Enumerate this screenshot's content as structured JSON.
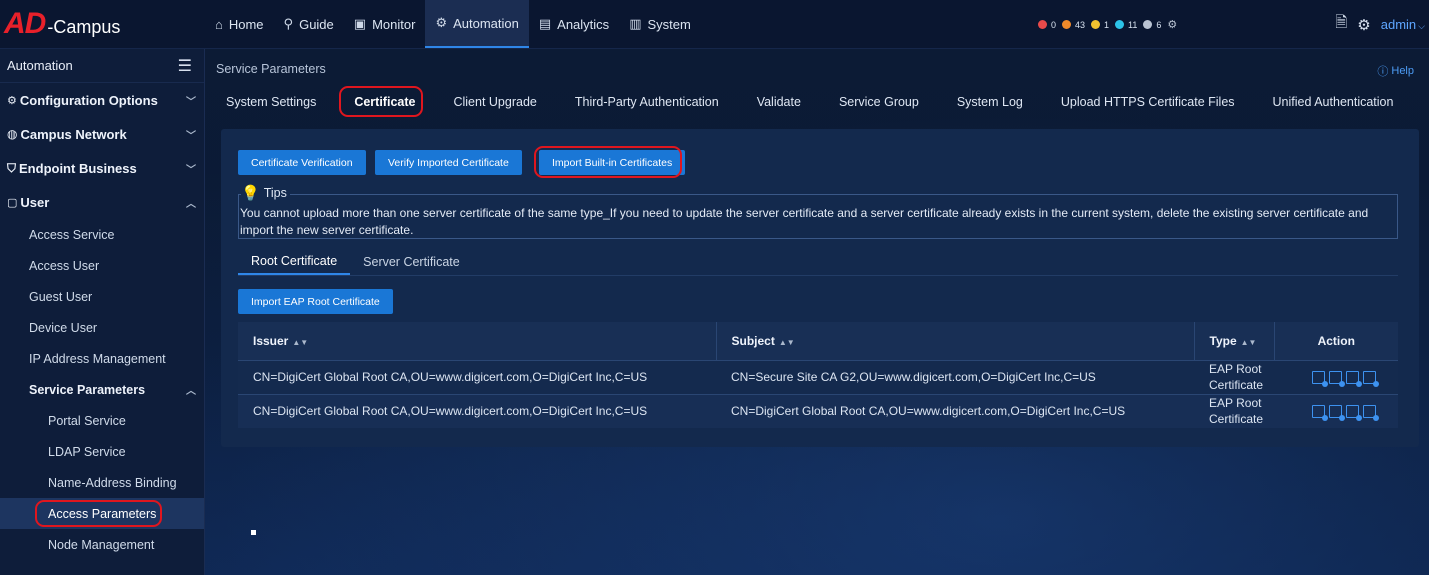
{
  "logo": {
    "brand": "AD",
    "product": "-Campus"
  },
  "topnav": [
    {
      "label": "Home",
      "icon": "home-icon",
      "glyph": "⌂"
    },
    {
      "label": "Guide",
      "icon": "guide-icon",
      "glyph": "⚲"
    },
    {
      "label": "Monitor",
      "icon": "monitor-icon",
      "glyph": "▣"
    },
    {
      "label": "Automation",
      "icon": "automation-icon",
      "glyph": "⚙"
    },
    {
      "label": "Analytics",
      "icon": "analytics-icon",
      "glyph": "▤"
    },
    {
      "label": "System",
      "icon": "system-icon",
      "glyph": "▥"
    }
  ],
  "alarms": [
    {
      "count": "0",
      "color": "#e84a4a"
    },
    {
      "count": "43",
      "color": "#f08a2a"
    },
    {
      "count": "1",
      "color": "#f2c230"
    },
    {
      "count": "11",
      "color": "#2cc3e8"
    },
    {
      "count": "6",
      "color": "#b9c3d2"
    }
  ],
  "user": {
    "name": "admin"
  },
  "sidebar": {
    "title": "Automation",
    "groups": [
      {
        "label": "Configuration Options"
      },
      {
        "label": "Campus Network"
      },
      {
        "label": "Endpoint Business"
      },
      {
        "label": "User"
      }
    ],
    "user_items": [
      "Access Service",
      "Access User",
      "Guest User",
      "Device User",
      "IP Address Management"
    ],
    "service_parameters": {
      "label": "Service Parameters",
      "items": [
        "Portal Service",
        "LDAP Service",
        "Name-Address Binding",
        "Access Parameters",
        "Node Management"
      ]
    }
  },
  "page": {
    "breadcrumb": "Service Parameters",
    "help": "Help",
    "tabs": [
      "System Settings",
      "Certificate",
      "Client Upgrade",
      "Third-Party Authentication",
      "Validate",
      "Service Group",
      "System Log",
      "Upload HTTPS Certificate Files",
      "Unified Authentication"
    ],
    "buttons": {
      "verify": "Certificate Verification",
      "verify_imported": "Verify Imported Certificate",
      "import_builtin": "Import Built-in Certificates",
      "import_eap": "Import EAP Root Certificate"
    },
    "tips": {
      "title": "Tips",
      "text": "You cannot upload more than one server certificate of the same type_If you need to update the server certificate and a server certificate already exists in the current system, delete the existing server certificate and import the new server certificate."
    },
    "subtabs": [
      "Root Certificate",
      "Server Certificate"
    ],
    "table": {
      "columns": [
        "Issuer",
        "Subject",
        "Type",
        "Action"
      ],
      "rows": [
        {
          "issuer": "CN=DigiCert Global Root CA,OU=www.digicert.com,O=DigiCert Inc,C=US",
          "subject": "CN=Secure Site CA G2,OU=www.digicert.com,O=DigiCert Inc,C=US",
          "type": "EAP Root Certificate"
        },
        {
          "issuer": "CN=DigiCert Global Root CA,OU=www.digicert.com,O=DigiCert Inc,C=US",
          "subject": "CN=DigiCert Global Root CA,OU=www.digicert.com,O=DigiCert Inc,C=US",
          "type": "EAP Root Certificate"
        }
      ]
    }
  }
}
